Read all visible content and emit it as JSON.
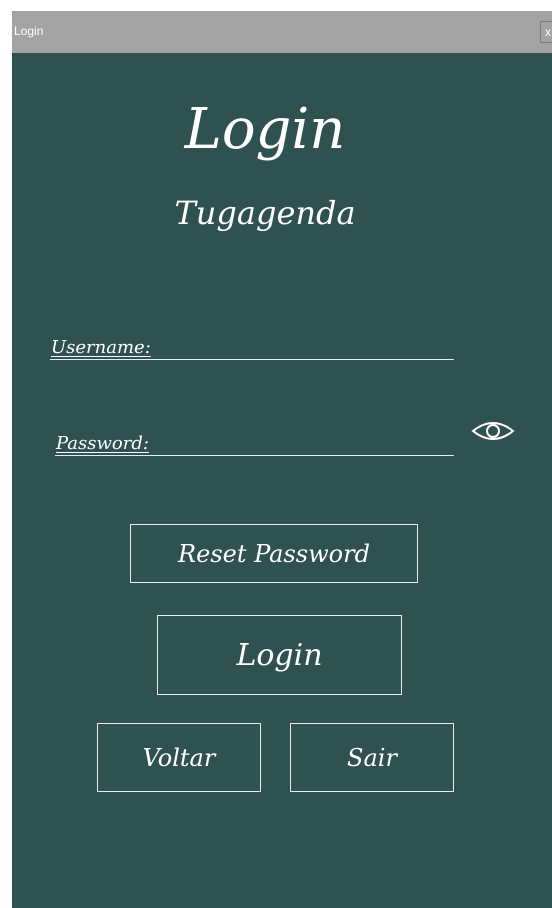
{
  "window": {
    "title": "Login",
    "close_label": "x"
  },
  "header": {
    "title": "Login",
    "subtitle": "Tugagenda"
  },
  "form": {
    "username_label": "Username:",
    "username_value": "",
    "password_label": "Password:",
    "password_value": "",
    "show_password_icon": "eye-icon"
  },
  "buttons": {
    "reset_password": "Reset Password",
    "login": "Login",
    "back": "Voltar",
    "exit": "Sair"
  },
  "colors": {
    "background": "#2f5250",
    "titlebar": "#a3a3a3",
    "text": "#ffffff"
  }
}
